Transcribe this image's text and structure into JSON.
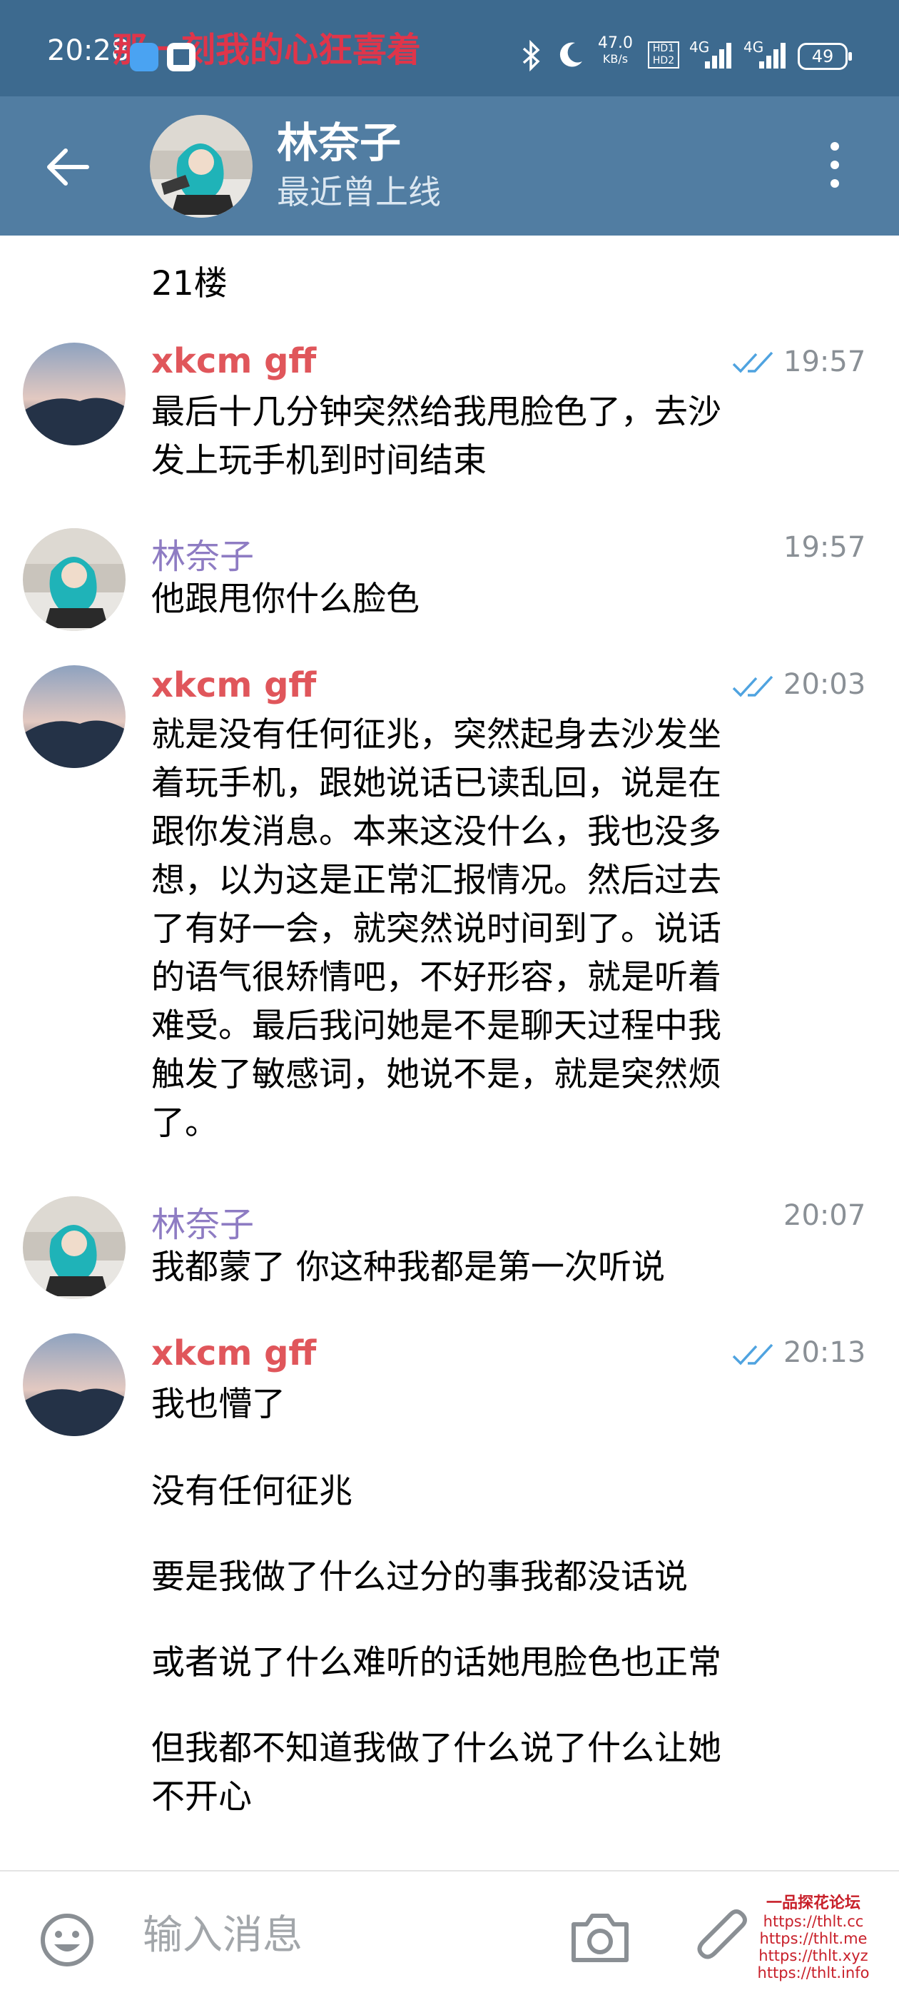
{
  "status_bar": {
    "time": "20:28",
    "marquee": "那一刻我的心狂喜着",
    "network_speed_value": "47.0",
    "network_speed_unit": "KB/s",
    "hd_label_1": "HD1",
    "hd_label_2": "HD2",
    "sig1_label": "4G",
    "sig2_label": "4G",
    "battery": "49"
  },
  "header": {
    "contact_name": "林奈子",
    "contact_status": "最近曾上线"
  },
  "messages": {
    "pre_text": "21楼",
    "m1": {
      "sender": "xkcm gff",
      "time": "19:57",
      "text": "最后十几分钟突然给我甩脸色了，去沙\n发上玩手机到时间结束"
    },
    "m2": {
      "sender": "林奈子",
      "time": "19:57",
      "text": "他跟甩你什么脸色"
    },
    "m3": {
      "sender": "xkcm gff",
      "time": "20:03",
      "text": "就是没有任何征兆，突然起身去沙发坐\n着玩手机，跟她说话已读乱回，说是在\n跟你发消息。本来这没什么，我也没多\n想，以为这是正常汇报情况。然后过去\n了有好一会，就突然说时间到了。说话\n的语气很矫情吧，不好形容，就是听着\n难受。最后我问她是不是聊天过程中我\n触发了敏感词，她说不是，就是突然烦\n了。"
    },
    "m4": {
      "sender": "林奈子",
      "time": "20:07",
      "text": "我都蒙了 你这种我都是第一次听说"
    },
    "m5": {
      "sender": "xkcm gff",
      "time": "20:13",
      "line1": "我也懵了",
      "line2": "没有任何征兆",
      "line3": "要是我做了什么过分的事我都没话说",
      "line4": "或者说了什么难听的话她甩脸色也正常",
      "line5": "但我都不知道我做了什么说了什么让她\n不开心"
    }
  },
  "input_bar": {
    "placeholder": "输入消息",
    "icons": [
      "emoji-icon",
      "camera-icon",
      "paperclip-icon"
    ]
  },
  "watermark": {
    "title": "一品探花论坛",
    "urls": [
      "https://thlt.cc",
      "https://thlt.me",
      "https://thlt.xyz",
      "https://thlt.info"
    ]
  },
  "colors": {
    "header_bg": "#517da2",
    "status_bg": "#3d6a8f",
    "sender_red": "#e0565b",
    "sender_purple": "#8e7cc3",
    "read_check": "#4fa3e0",
    "time_gray": "#8a9096"
  }
}
